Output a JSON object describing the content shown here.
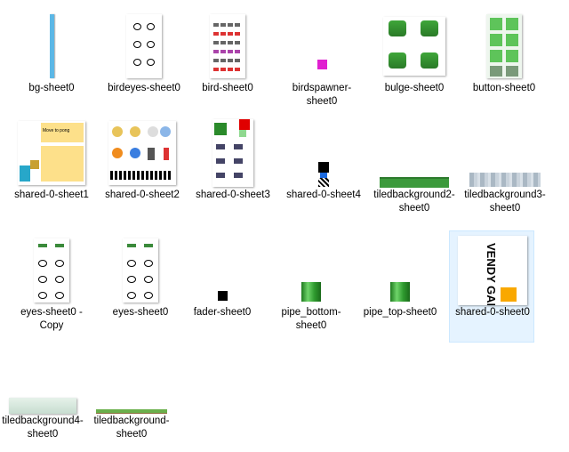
{
  "files": [
    {
      "name": "bg-sheet0"
    },
    {
      "name": "birdeyes-sheet0"
    },
    {
      "name": "bird-sheet0"
    },
    {
      "name": "birdspawner-sheet0"
    },
    {
      "name": "bulge-sheet0"
    },
    {
      "name": "button-sheet0"
    },
    {
      "name": "shared-0-sheet1"
    },
    {
      "name": "shared-0-sheet2"
    },
    {
      "name": "shared-0-sheet3"
    },
    {
      "name": "shared-0-sheet4"
    },
    {
      "name": "tiledbackground2-sheet0"
    },
    {
      "name": "tiledbackground3-sheet0"
    },
    {
      "name": "eyes-sheet0 - Copy"
    },
    {
      "name": "eyes-sheet0"
    },
    {
      "name": "fader-sheet0"
    },
    {
      "name": "pipe_bottom-sheet0"
    },
    {
      "name": "pipe_top-sheet0"
    },
    {
      "name": "shared-0-sheet0"
    },
    {
      "name": "tiledbackground4-sheet0"
    },
    {
      "name": "tiledbackground-sheet0"
    }
  ],
  "thumbnails": {
    "shared_sheet1_text": "Move to pong",
    "vendy_logo": "VENDY GAMES"
  },
  "colors": {
    "selection_bg": "#e5f3ff",
    "selection_border": "#cce8ff",
    "birdspawner": "#e020d0",
    "pipe_green": "#3fa63a",
    "sky_blue": "#5bb7e6",
    "orange": "#f9a800"
  }
}
